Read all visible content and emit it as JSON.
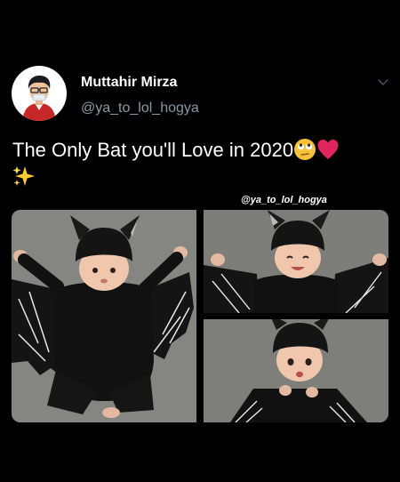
{
  "author": {
    "name": "Muttahir Mirza",
    "handle": "@ya_to_lol_hogya",
    "avatar_icon": "cartoon-avatar-icon"
  },
  "menu_icon": "chevron-down-icon",
  "tweet": {
    "text_line1": "The Only Bat you'll Love in 2020",
    "emojis": [
      "rolling-eyes-emoji-icon",
      "red-heart-emoji-icon",
      "sparkles-emoji-icon"
    ]
  },
  "media": {
    "watermark": "@ya_to_lol_hogya",
    "photos": [
      "baby-bat-costume-photo-full",
      "baby-bat-costume-photo-smiling",
      "baby-bat-costume-photo-sitting"
    ]
  },
  "colors": {
    "background": "#000000",
    "text_primary": "#ffffff",
    "text_secondary": "#8899a6",
    "heart": "#e0245e",
    "photo_background": "#7f7f7b"
  }
}
